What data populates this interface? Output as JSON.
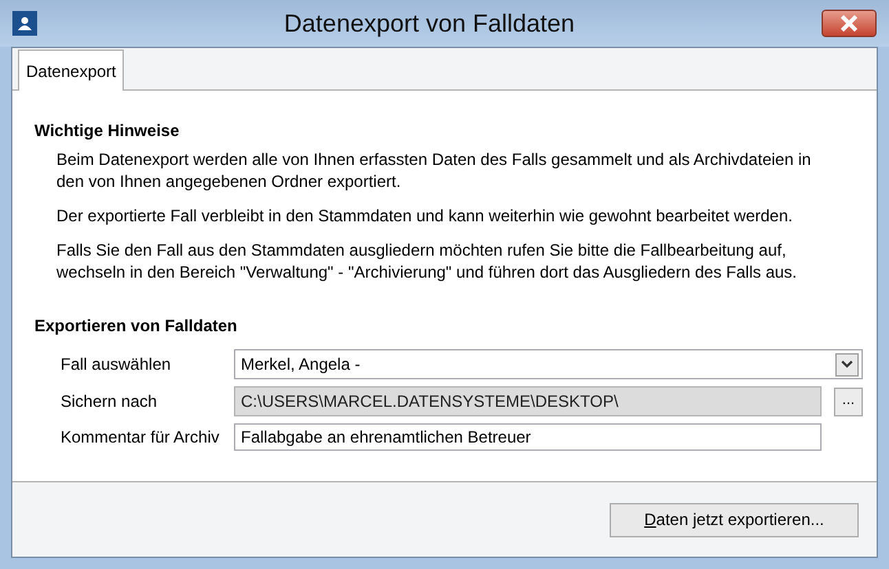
{
  "window": {
    "title": "Datenexport von Falldaten"
  },
  "tabs": [
    {
      "label": "Datenexport",
      "selected": true
    }
  ],
  "notes": {
    "heading": "Wichtige Hinweise",
    "paragraphs": [
      "Beim Datenexport werden alle von Ihnen erfassten Daten des Falls gesammelt und als Archivdateien in den von Ihnen angegebenen Ordner exportiert.",
      "Der exportierte Fall verbleibt in den Stammdaten und kann weiterhin wie gewohnt bearbeitet werden.",
      "Falls Sie den Fall aus den Stammdaten ausgliedern möchten rufen Sie bitte die Fallbearbeitung auf, wechseln in den Bereich \"Verwaltung\" - \"Archivierung\" und führen dort das Ausgliedern des Falls aus."
    ]
  },
  "export": {
    "heading": "Exportieren von Falldaten",
    "fields": [
      {
        "kind": "dropdown",
        "label": "Fall auswählen",
        "value": "Merkel, Angela -"
      },
      {
        "kind": "path",
        "label": "Sichern nach",
        "value": "C:\\USERS\\MARCEL.DATENSYSTEME\\DESKTOP\\",
        "button": "..."
      },
      {
        "kind": "text",
        "label": "Kommentar für Archiv",
        "value": "Fallabgabe an ehrenamtlichen Betreuer"
      }
    ]
  },
  "buttons": [
    "Daten jetzt exportieren..."
  ]
}
